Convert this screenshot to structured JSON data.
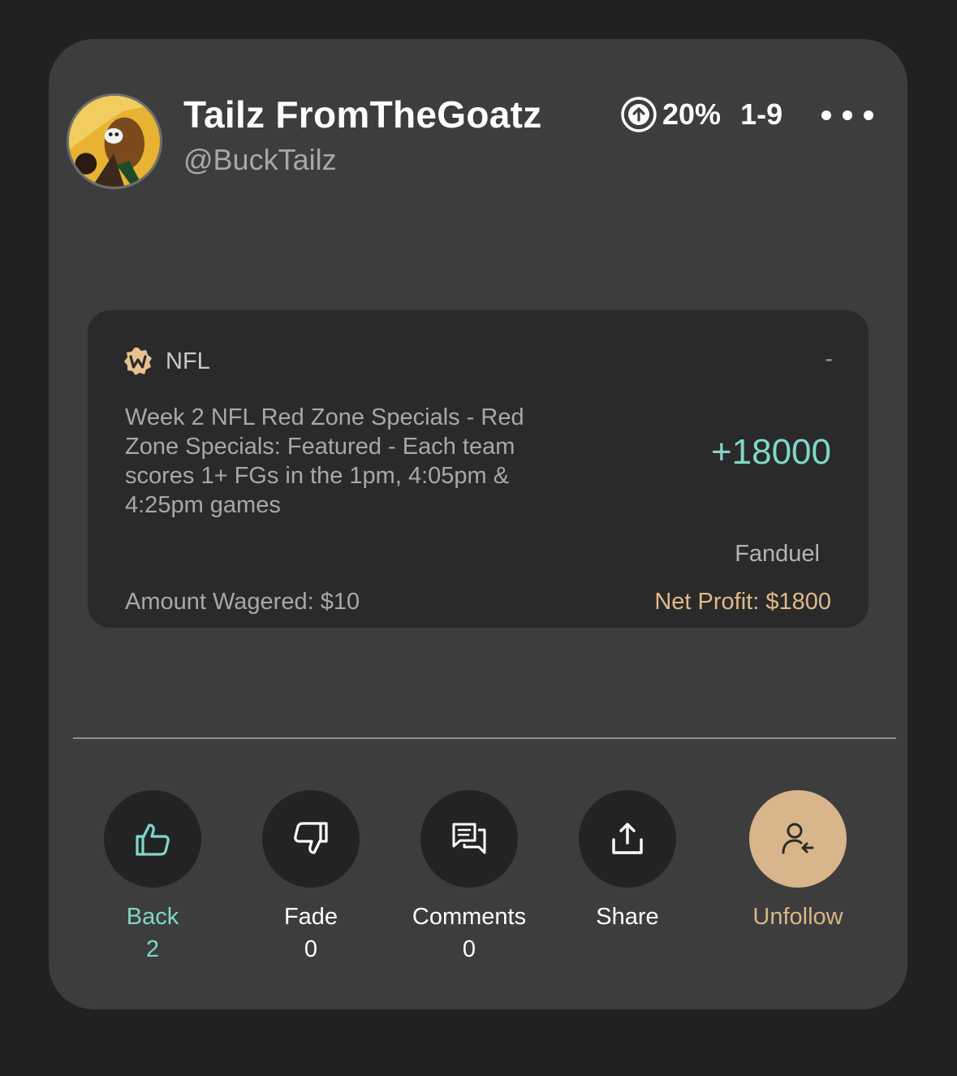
{
  "user": {
    "name": "Tailz FromTheGoatz",
    "handle": "@BuckTailz",
    "roi": "20%",
    "record": "1-9"
  },
  "bet": {
    "league": "NFL",
    "status": "-",
    "description": "Week 2 NFL Red Zone Specials - Red Zone Specials: Featured - Each team scores 1+ FGs in the 1pm, 4:05pm & 4:25pm games",
    "odds": "+18000",
    "sportsbook": "Fanduel",
    "amount_wagered": "Amount Wagered: $10",
    "net_profit": "Net Profit: $1800"
  },
  "actions": {
    "back": {
      "label": "Back",
      "count": "2"
    },
    "fade": {
      "label": "Fade",
      "count": "0"
    },
    "comments": {
      "label": "Comments",
      "count": "0"
    },
    "share": {
      "label": "Share"
    },
    "unfollow": {
      "label": "Unfollow"
    }
  },
  "colors": {
    "background": "#212121",
    "card": "#3d3d3d",
    "bet_card": "#2a2a2a",
    "teal_accent": "#7fd8c8",
    "tan_accent": "#d8b58a"
  },
  "icons": {
    "roi": "arrow-up-circle-icon",
    "more": "more-dots-icon",
    "league": "w-badge-icon",
    "back": "thumbs-up-icon",
    "fade": "thumbs-down-icon",
    "comments": "comments-icon",
    "share": "share-icon",
    "unfollow": "user-unfollow-icon"
  }
}
